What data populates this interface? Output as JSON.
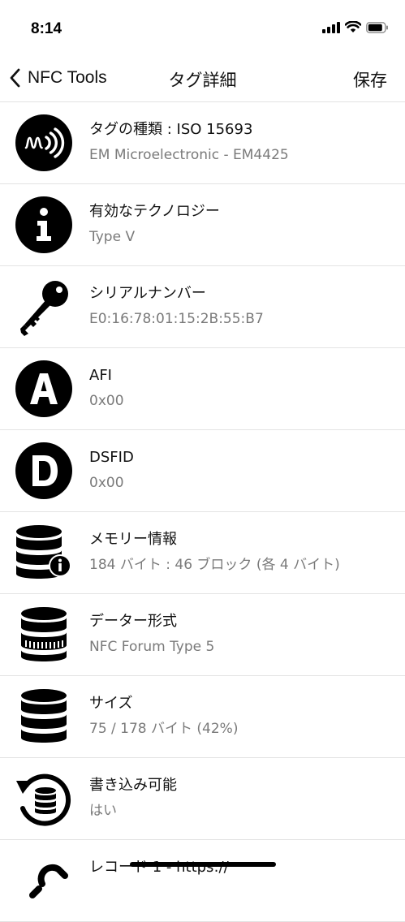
{
  "status": {
    "time": "8:14"
  },
  "nav": {
    "back_label": "NFC Tools",
    "title": "タグ詳細",
    "save_label": "保存"
  },
  "rows": [
    {
      "title": "タグの種類 : ISO 15693",
      "value": "EM Microelectronic - EM4425",
      "icon": "nfc-tag-icon"
    },
    {
      "title": "有効なテクノロジー",
      "value": "Type V",
      "icon": "info-icon"
    },
    {
      "title": "シリアルナンバー",
      "value": "E0:16:78:01:15:2B:55:B7",
      "icon": "key-icon"
    },
    {
      "title": "AFI",
      "value": "0x00",
      "icon": "letter-a-icon"
    },
    {
      "title": "DSFID",
      "value": "0x00",
      "icon": "letter-d-icon"
    },
    {
      "title": "メモリー情報",
      "value": "184 バイト : 46 ブロック (各 4 バイト)",
      "icon": "database-info-icon"
    },
    {
      "title": "データー形式",
      "value": "NFC Forum Type 5",
      "icon": "database-format-icon"
    },
    {
      "title": "サイズ",
      "value": "75 / 178 バイト (42%)",
      "icon": "database-icon"
    },
    {
      "title": "書き込み可能",
      "value": "はい",
      "icon": "database-refresh-icon"
    },
    {
      "title": "レコード 1 - https://",
      "value": "",
      "icon": "link-icon"
    }
  ]
}
